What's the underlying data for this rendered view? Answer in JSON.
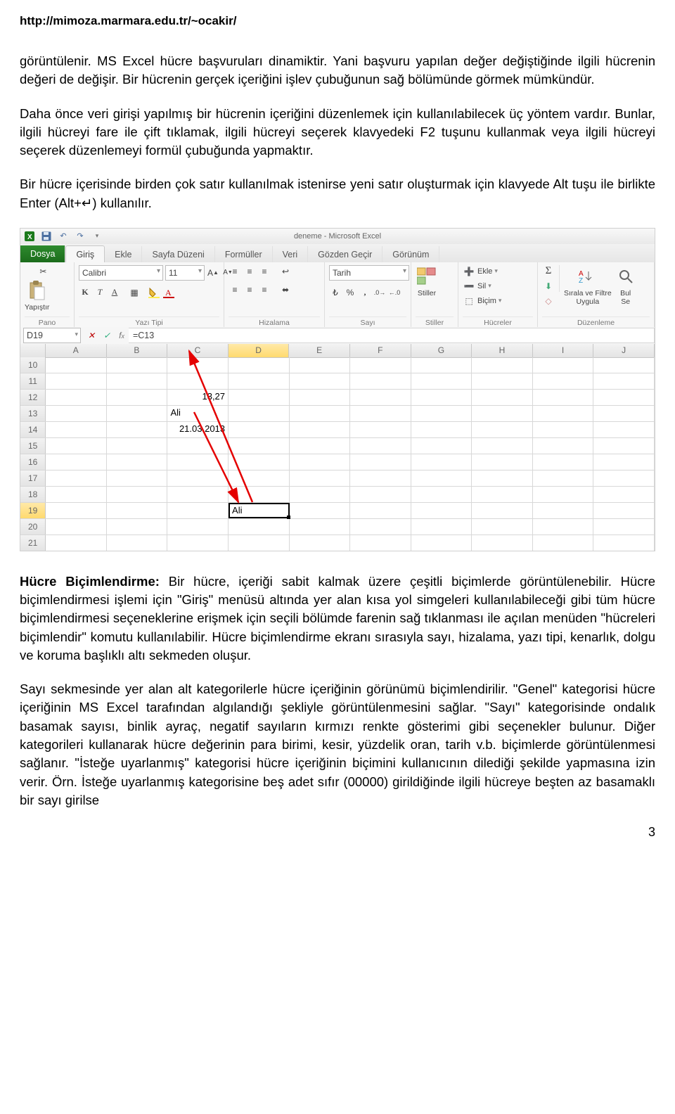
{
  "header_url": "http://mimoza.marmara.edu.tr/~ocakir/",
  "para1": "görüntülenir. MS Excel hücre başvuruları dinamiktir. Yani başvuru yapılan değer değiştiğinde ilgili hücrenin değeri de değişir. Bir hücrenin gerçek içeriğini işlev çubuğunun sağ bölümünde görmek mümkündür.",
  "para2": "Daha önce veri girişi yapılmış bir hücrenin içeriğini düzenlemek için kullanılabilecek üç yöntem vardır. Bunlar, ilgili hücreyi fare ile çift tıklamak, ilgili hücreyi seçerek klavyedeki F2 tuşunu kullanmak veya ilgili hücreyi seçerek düzenlemeyi formül çubuğunda yapmaktır.",
  "para3": "Bir hücre içerisinde birden çok satır kullanılmak istenirse yeni satır oluşturmak için klavyede Alt tuşu ile birlikte Enter (Alt+↵) kullanılır.",
  "para4_lead": "Hücre Biçimlendirme:",
  "para4": " Bir hücre, içeriği sabit kalmak üzere çeşitli biçimlerde görüntülenebilir. Hücre biçimlendirmesi işlemi için \"Giriş\" menüsü altında yer alan kısa yol simgeleri kullanılabileceği gibi tüm hücre biçimlendirmesi seçeneklerine erişmek için seçili bölümde farenin sağ tıklanması ile açılan menüden \"hücreleri biçimlendir\" komutu kullanılabilir. Hücre biçimlendirme ekranı sırasıyla sayı, hizalama, yazı tipi, kenarlık, dolgu ve koruma başlıklı altı sekmeden oluşur.",
  "para5": "Sayı sekmesinde yer alan alt kategorilerle hücre içeriğinin görünümü biçimlendirilir. \"Genel\" kategorisi hücre içeriğinin MS Excel tarafından algılandığı şekliyle görüntülenmesini sağlar. \"Sayı\" kategorisinde ondalık basamak sayısı, binlik ayraç, negatif sayıların kırmızı renkte gösterimi gibi seçenekler bulunur.  Diğer kategorileri kullanarak hücre değerinin para birimi, kesir, yüzdelik oran, tarih v.b. biçimlerde görüntülenmesi sağlanır. \"İsteğe uyarlanmış\" kategorisi hücre içeriğinin biçimini kullanıcının dilediği şekilde yapmasına izin verir. Örn. İsteğe uyarlanmış kategorisine beş adet sıfır (00000) girildiğinde ilgili hücreye beşten az basamaklı bir sayı girilse",
  "page_num": "3",
  "excel": {
    "title": "deneme  -  Microsoft Excel",
    "tabs": {
      "file": "Dosya",
      "home": "Giriş",
      "insert": "Ekle",
      "layout": "Sayfa Düzeni",
      "formulas": "Formüller",
      "data": "Veri",
      "review": "Gözden Geçir",
      "view": "Görünüm"
    },
    "ribbon": {
      "paste": "Yapıştır",
      "pano": "Pano",
      "font_name": "Calibri",
      "font_size": "11",
      "font_group": "Yazı Tipi",
      "align_group": "Hizalama",
      "number_format": "Tarih",
      "number_group": "Sayı",
      "styles": "Stiller",
      "insert_btn": "Ekle",
      "delete_btn": "Sil",
      "format_btn": "Biçim",
      "cells_group": "Hücreler",
      "sort_filter": "Sırala ve Filtre\nUygula",
      "find": "Bul\nSe",
      "edit_group": "Düzenleme"
    },
    "namebox": "D19",
    "formula": "=C13",
    "columns": [
      "A",
      "B",
      "C",
      "D",
      "E",
      "F",
      "G",
      "H",
      "I",
      "J"
    ],
    "rows": [
      "10",
      "11",
      "12",
      "13",
      "14",
      "15",
      "16",
      "17",
      "18",
      "19",
      "20",
      "21"
    ],
    "cells": {
      "C12": "13,27",
      "C13": "Ali",
      "C14": "21.03.2013",
      "D19": "Ali"
    },
    "active_col_idx": 3,
    "active_row_label": "19"
  }
}
